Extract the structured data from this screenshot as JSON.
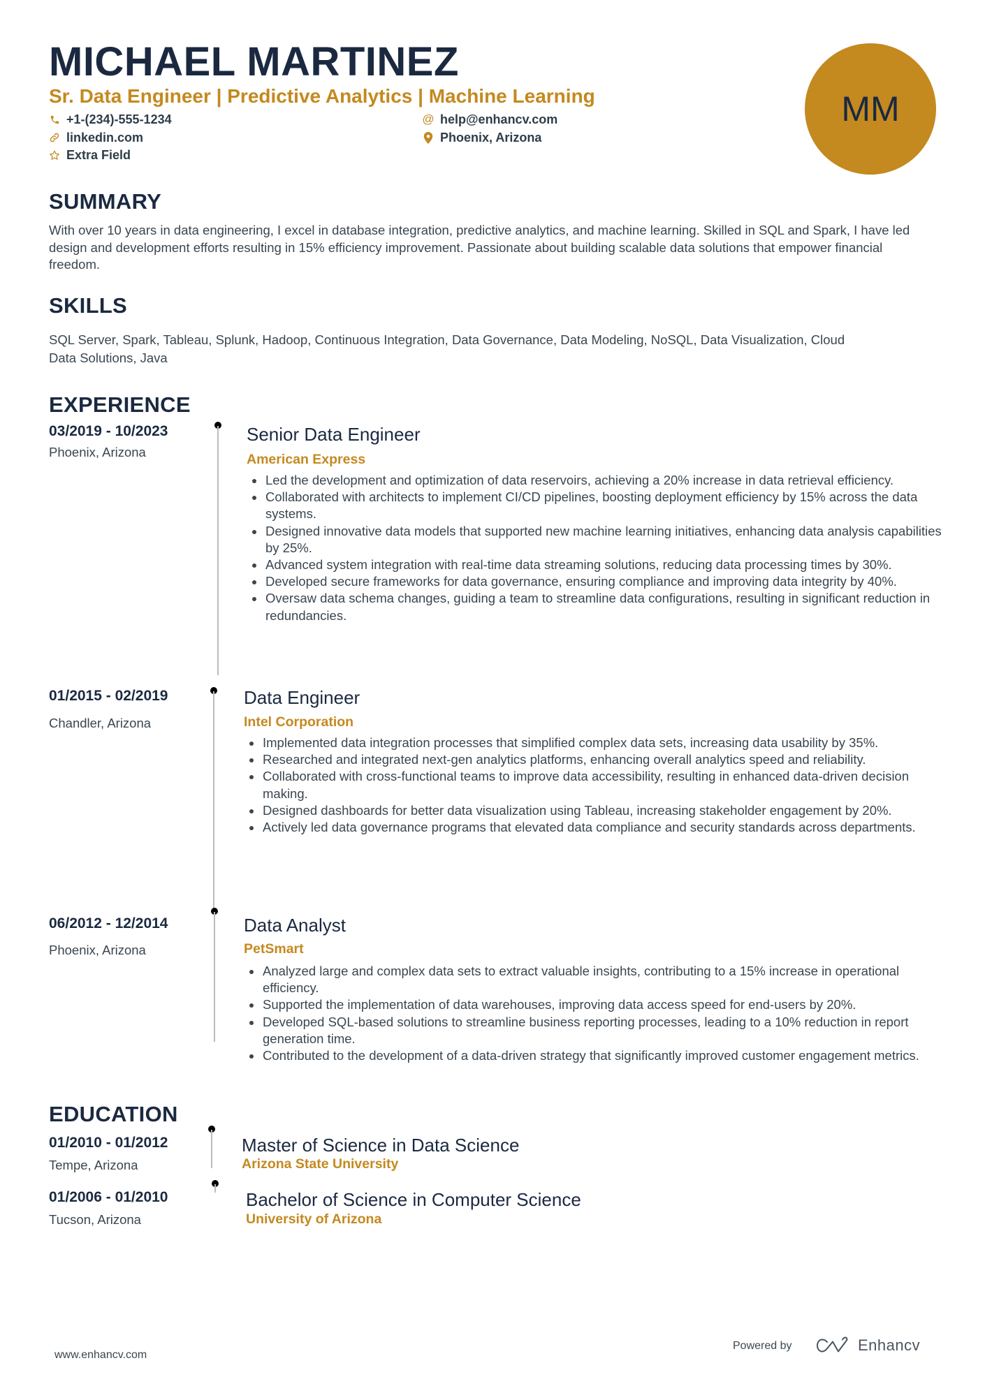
{
  "header": {
    "name": "MICHAEL MARTINEZ",
    "headline": "Sr. Data Engineer | Predictive Analytics | Machine Learning",
    "initials": "MM",
    "contacts": {
      "phone": {
        "icon": "phone-icon",
        "value": "+1-(234)-555-1234"
      },
      "email": {
        "icon": "at-icon",
        "value": "help@enhancv.com"
      },
      "link": {
        "icon": "link-icon",
        "value": "linkedin.com"
      },
      "location": {
        "icon": "map-pin-icon",
        "value": "Phoenix, Arizona"
      },
      "extra": {
        "icon": "star-icon",
        "value": "Extra Field"
      }
    }
  },
  "summary": {
    "heading": "SUMMARY",
    "text": "With over 10 years in data engineering, I excel in database integration, predictive analytics, and machine learning. Skilled in SQL and Spark, I have led design and development efforts resulting in 15% efficiency improvement. Passionate about building scalable data solutions that empower financial freedom."
  },
  "skills": {
    "heading": "SKILLS",
    "text": "SQL Server, Spark, Tableau, Splunk, Hadoop, Continuous Integration, Data Governance, Data Modeling, NoSQL, Data Visualization, Cloud Data Solutions, Java"
  },
  "experience": {
    "heading": "EXPERIENCE",
    "jobs": [
      {
        "dates": "03/2019 - 10/2023",
        "location": "Phoenix, Arizona",
        "title": "Senior Data Engineer",
        "company": "American Express",
        "bullets": [
          "Led the development and optimization of data reservoirs, achieving a 20% increase in data retrieval efficiency.",
          "Collaborated with architects to implement CI/CD pipelines, boosting deployment efficiency by 15% across the data systems.",
          "Designed innovative data models that supported new machine learning initiatives, enhancing data analysis capabilities by 25%.",
          "Advanced system integration with real-time data streaming solutions, reducing data processing times by 30%.",
          "Developed secure frameworks for data governance, ensuring compliance and improving data integrity by 40%.",
          "Oversaw data schema changes, guiding a team to streamline data configurations, resulting in significant reduction in redundancies."
        ]
      },
      {
        "dates": "01/2015 - 02/2019",
        "location": "Chandler, Arizona",
        "title": "Data Engineer",
        "company": "Intel Corporation",
        "bullets": [
          "Implemented data integration processes that simplified complex data sets, increasing data usability by 35%.",
          "Researched and integrated next-gen analytics platforms, enhancing overall analytics speed and reliability.",
          "Collaborated with cross-functional teams to improve data accessibility, resulting in enhanced data-driven decision making.",
          "Designed dashboards for better data visualization using Tableau, increasing stakeholder engagement by 20%.",
          "Actively led data governance programs that elevated data compliance and security standards across departments."
        ]
      },
      {
        "dates": "06/2012 - 12/2014",
        "location": "Phoenix, Arizona",
        "title": "Data Analyst",
        "company": "PetSmart",
        "bullets": [
          "Analyzed large and complex data sets to extract valuable insights, contributing to a 15% increase in operational efficiency.",
          "Supported the implementation of data warehouses, improving data access speed for end-users by 20%.",
          "Developed SQL-based solutions to streamline business reporting processes, leading to a 10% reduction in report generation time.",
          "Contributed to the development of a data-driven strategy that significantly improved customer engagement metrics."
        ]
      }
    ]
  },
  "education": {
    "heading": "EDUCATION",
    "items": [
      {
        "dates": "01/2010 - 01/2012",
        "location": "Tempe, Arizona",
        "degree": "Master of Science in Data Science",
        "school": "Arizona State University"
      },
      {
        "dates": "01/2006 - 01/2010",
        "location": "Tucson, Arizona",
        "degree": "Bachelor of Science in Computer Science",
        "school": "University of Arizona"
      }
    ]
  },
  "footer": {
    "website": "www.enhancv.com",
    "powered_by": "Powered by",
    "brand": "Enhancv",
    "brand_icon": "enhancv-logo-icon"
  },
  "colors": {
    "accent": "#c4891f",
    "heading": "#1b2940",
    "body": "#3a4650",
    "timeline": "#b8bcc0"
  }
}
